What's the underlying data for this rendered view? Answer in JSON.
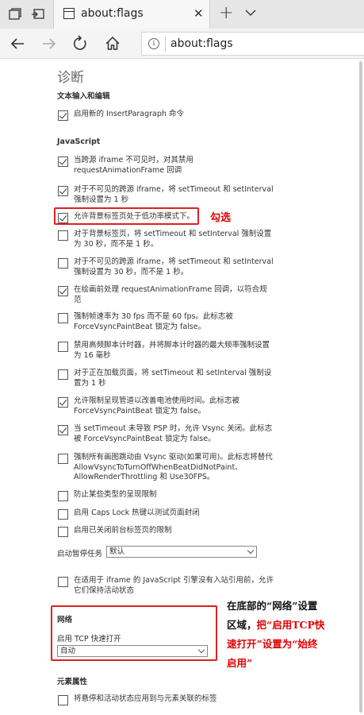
{
  "tab": {
    "title": "about:flags"
  },
  "address": {
    "url": "about:flags"
  },
  "page": {
    "heading": "诊断",
    "section_text_input": "文本输入和编辑",
    "item_insertparagraph": "启用新的 InsertParagraph 命令",
    "section_js": "JavaScript",
    "js_items": [
      {
        "label": "当跨源 iframe 不可见时，对其禁用 requestAnimationFrame 回调",
        "checked": true
      },
      {
        "label": "对于不可见的跨源 iframe，将 setTimeout 和 setInterval 强制设置为 1 秒",
        "checked": true
      },
      {
        "label": "允许背景标签页处于低功率模式下。",
        "checked": true
      },
      {
        "label": "对于背景标签页，将 setTimeout 和 setInterval 强制设置为 30 秒，而不是 1 秒。",
        "checked": false
      },
      {
        "label": "对于不可见的跨源 iframe，将 setTimeout 和 setInterval 强制设置为 30 秒，而不是 1 秒。",
        "checked": false
      },
      {
        "label": "在绘画前处理 requestAnimationFrame 回调，以符合规范",
        "checked": true
      },
      {
        "label": "强制帧速率为 30 fps 而不是 60 fps。此标志被 ForceVsyncPaintBeat 锁定为 false。",
        "checked": false
      },
      {
        "label": "禁用高频脚本计时器，并将脚本计时器的最大频率强制设置为 16 毫秒",
        "checked": false
      },
      {
        "label": "对于正在加载页面，将 setTimeout 和 setInterval 强制设置为 1 秒",
        "checked": false
      },
      {
        "label": "允许限制呈现管道以改善电池使用时间。此标志被 ForceVsyncPaintBeat 锁定为 false。",
        "checked": true
      },
      {
        "label": "当 setTimeout 未导致 PSP 时，允许 Vsync 关闭。此标志被 ForceVsyncPaintBeat 锁定为 false。",
        "checked": true
      },
      {
        "label": "强制所有画图跳动由 Vsync 驱动(如果可用)。此标志将替代 AllowVsyncToTurnOffWhenBeatDidNotPaint、AllowRenderThrottling 和 Use30FPS。",
        "checked": false
      },
      {
        "label": "防止某些类型的呈现限制",
        "checked": false
      },
      {
        "label": "启用 Caps Lock 热键以测试页面封闭",
        "checked": false
      },
      {
        "label": "启用已关闭前台标签页的限制",
        "checked": false
      }
    ],
    "startup_label": "启动暂停任务",
    "startup_value": "默认",
    "item_iframe": "在适用于 iframe 的 JavaScript 引擎没有入站引用前，允许它们保持活动状态",
    "section_network": "网络",
    "tcp_label": "启用 TCP 快速打开",
    "tcp_value": "自动",
    "section_elements": "元素属性",
    "item_elements": "将悬停和活动状态应用到与元素关联的标签"
  },
  "annotations": {
    "check_note": "勾选",
    "note_line1": "在底部的“网络”设置",
    "note_line2": "区域，",
    "note_line2_red": "把“启用TCP快",
    "note_line3_red": "速打开”设置为“始终",
    "note_line4_red": "启用”"
  },
  "colors": {
    "highlight": "#e02020",
    "annotation_red": "#e00000"
  }
}
